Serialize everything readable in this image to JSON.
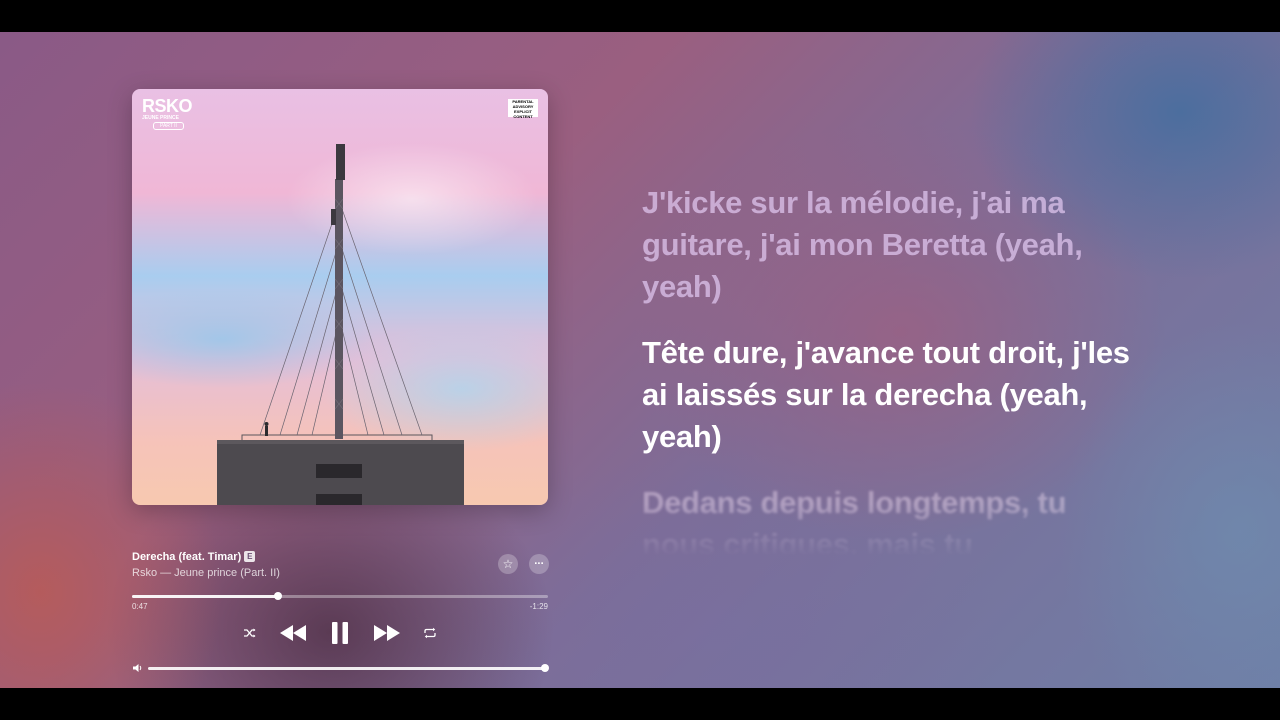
{
  "album": {
    "art_logo": "RSKO",
    "art_subtitle": "JEUNE PRINCE",
    "art_part": "PART II",
    "art_advisory": "PARENTAL ADVISORY EXPLICIT CONTENT"
  },
  "track": {
    "title": "Derecha (feat. Timar)",
    "explicit_badge": "E",
    "artist_album": "Rsko — Jeune prince (Part. II)"
  },
  "playback": {
    "elapsed": "0:47",
    "remaining": "-1:29",
    "progress_fraction": 0.35,
    "volume_fraction": 1.0,
    "state": "playing"
  },
  "icons": {
    "favorite": "star-icon",
    "more": "ellipsis-icon",
    "shuffle": "shuffle-icon",
    "previous": "rewind-icon",
    "pause": "pause-icon",
    "next": "fast-forward-icon",
    "repeat": "repeat-icon",
    "volume": "speaker-icon"
  },
  "icon_glyphs": {
    "favorite": "☆",
    "more": "···"
  },
  "lyrics": {
    "past": "J'kicke sur la mélodie, j'ai ma guitare, j'ai mon Beretta (yeah, yeah)",
    "current": "Tête dure, j'avance tout droit, j'les ai laissés sur la derecha (yeah, yeah)",
    "upcoming": "Dedans depuis longtemps, tu nous critiques, mais tu"
  }
}
